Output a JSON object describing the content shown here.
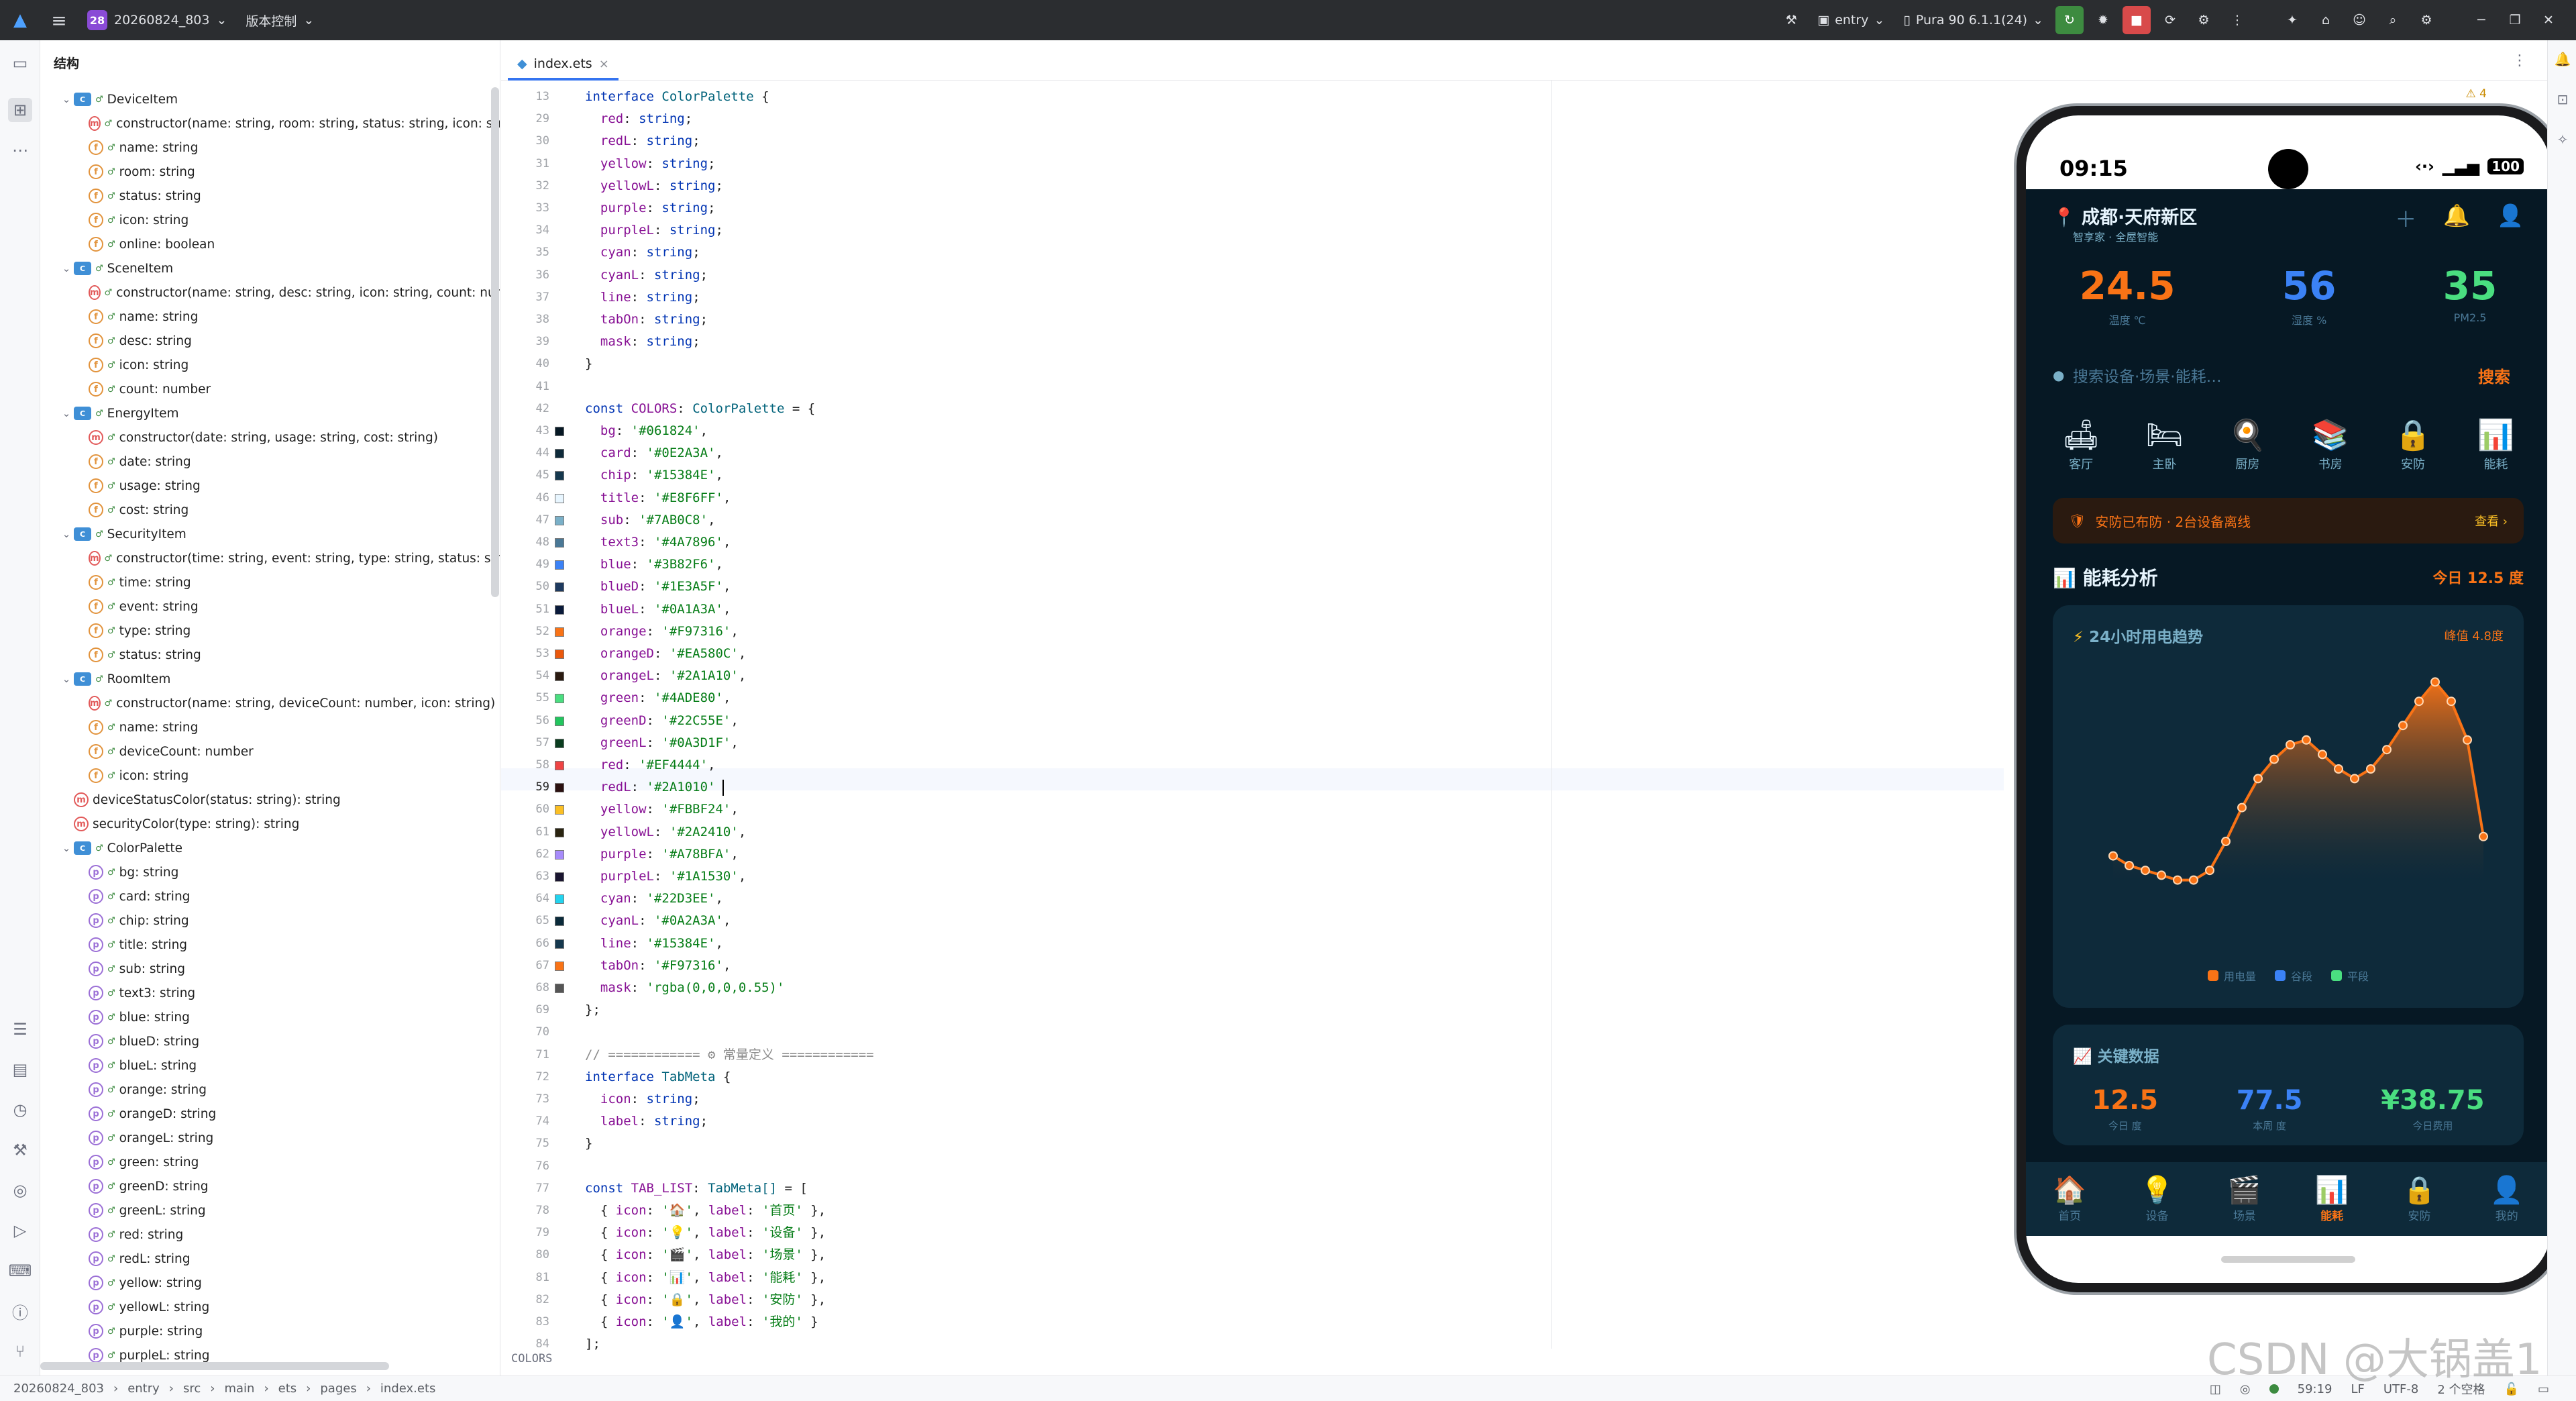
{
  "titlebar": {
    "project_badge": "28",
    "project_name": "20260824_803",
    "vcs": "版本控制",
    "run_config": "entry",
    "device": "Pura 90 6.1.1(24)"
  },
  "structure": {
    "title": "结构",
    "items": [
      {
        "level": 0,
        "kind": "class",
        "expand": true,
        "text": "DeviceItem"
      },
      {
        "level": 1,
        "kind": "method",
        "text": "constructor(name: string, room: string, status: string, icon: string,"
      },
      {
        "level": 1,
        "kind": "field",
        "text": "name: string"
      },
      {
        "level": 1,
        "kind": "field",
        "text": "room: string"
      },
      {
        "level": 1,
        "kind": "field",
        "text": "status: string"
      },
      {
        "level": 1,
        "kind": "field",
        "text": "icon: string"
      },
      {
        "level": 1,
        "kind": "field",
        "text": "online: boolean"
      },
      {
        "level": 0,
        "kind": "class",
        "expand": true,
        "text": "SceneItem"
      },
      {
        "level": 1,
        "kind": "method",
        "text": "constructor(name: string, desc: string, icon: string, count: number"
      },
      {
        "level": 1,
        "kind": "field",
        "text": "name: string"
      },
      {
        "level": 1,
        "kind": "field",
        "text": "desc: string"
      },
      {
        "level": 1,
        "kind": "field",
        "text": "icon: string"
      },
      {
        "level": 1,
        "kind": "field",
        "text": "count: number"
      },
      {
        "level": 0,
        "kind": "class",
        "expand": true,
        "text": "EnergyItem"
      },
      {
        "level": 1,
        "kind": "method",
        "text": "constructor(date: string, usage: string, cost: string)"
      },
      {
        "level": 1,
        "kind": "field",
        "text": "date: string"
      },
      {
        "level": 1,
        "kind": "field",
        "text": "usage: string"
      },
      {
        "level": 1,
        "kind": "field",
        "text": "cost: string"
      },
      {
        "level": 0,
        "kind": "class",
        "expand": true,
        "text": "SecurityItem"
      },
      {
        "level": 1,
        "kind": "method",
        "text": "constructor(time: string, event: string, type: string, status: string)"
      },
      {
        "level": 1,
        "kind": "field",
        "text": "time: string"
      },
      {
        "level": 1,
        "kind": "field",
        "text": "event: string"
      },
      {
        "level": 1,
        "kind": "field",
        "text": "type: string"
      },
      {
        "level": 1,
        "kind": "field",
        "text": "status: string"
      },
      {
        "level": 0,
        "kind": "class",
        "expand": true,
        "text": "RoomItem"
      },
      {
        "level": 1,
        "kind": "method",
        "text": "constructor(name: string, deviceCount: number, icon: string)"
      },
      {
        "level": 1,
        "kind": "field",
        "text": "name: string"
      },
      {
        "level": 1,
        "kind": "field",
        "text": "deviceCount: number"
      },
      {
        "level": 1,
        "kind": "field",
        "text": "icon: string"
      },
      {
        "level": 0,
        "kind": "func",
        "text": "deviceStatusColor(status: string): string"
      },
      {
        "level": 0,
        "kind": "func",
        "text": "securityColor(type: string): string"
      },
      {
        "level": 0,
        "kind": "class",
        "expand": true,
        "text": "ColorPalette"
      },
      {
        "level": 1,
        "kind": "prop",
        "text": "bg: string"
      },
      {
        "level": 1,
        "kind": "prop",
        "text": "card: string"
      },
      {
        "level": 1,
        "kind": "prop",
        "text": "chip: string"
      },
      {
        "level": 1,
        "kind": "prop",
        "text": "title: string"
      },
      {
        "level": 1,
        "kind": "prop",
        "text": "sub: string"
      },
      {
        "level": 1,
        "kind": "prop",
        "text": "text3: string"
      },
      {
        "level": 1,
        "kind": "prop",
        "text": "blue: string"
      },
      {
        "level": 1,
        "kind": "prop",
        "text": "blueD: string"
      },
      {
        "level": 1,
        "kind": "prop",
        "text": "blueL: string"
      },
      {
        "level": 1,
        "kind": "prop",
        "text": "orange: string"
      },
      {
        "level": 1,
        "kind": "prop",
        "text": "orangeD: string"
      },
      {
        "level": 1,
        "kind": "prop",
        "text": "orangeL: string"
      },
      {
        "level": 1,
        "kind": "prop",
        "text": "green: string"
      },
      {
        "level": 1,
        "kind": "prop",
        "text": "greenD: string"
      },
      {
        "level": 1,
        "kind": "prop",
        "text": "greenL: string"
      },
      {
        "level": 1,
        "kind": "prop",
        "text": "red: string"
      },
      {
        "level": 1,
        "kind": "prop",
        "text": "redL: string"
      },
      {
        "level": 1,
        "kind": "prop",
        "text": "yellow: string"
      },
      {
        "level": 1,
        "kind": "prop",
        "text": "yellowL: string"
      },
      {
        "level": 1,
        "kind": "prop",
        "text": "purple: string"
      },
      {
        "level": 1,
        "kind": "prop",
        "text": "purpleL: string"
      }
    ]
  },
  "editor": {
    "tab": "index.ets",
    "inspection": "⚠ 4",
    "breadcrumb": "COLORS",
    "lines": [
      {
        "n": "13",
        "text": "interface ColorPalette {",
        "style": "kw-head"
      },
      {
        "n": "29",
        "text": "  red: string;",
        "style": "field"
      },
      {
        "n": "30",
        "text": "  redL: string;",
        "style": "field"
      },
      {
        "n": "31",
        "text": "  yellow: string;",
        "style": "field"
      },
      {
        "n": "32",
        "text": "  yellowL: string;",
        "style": "field"
      },
      {
        "n": "33",
        "text": "  purple: string;",
        "style": "field"
      },
      {
        "n": "34",
        "text": "  purpleL: string;",
        "style": "field"
      },
      {
        "n": "35",
        "text": "  cyan: string;",
        "style": "field"
      },
      {
        "n": "36",
        "text": "  cyanL: string;",
        "style": "field"
      },
      {
        "n": "37",
        "text": "  line: string;",
        "style": "field"
      },
      {
        "n": "38",
        "text": "  tabOn: string;",
        "style": "field"
      },
      {
        "n": "39",
        "text": "  mask: string;",
        "style": "field"
      },
      {
        "n": "40",
        "text": "}",
        "style": "plain"
      },
      {
        "n": "41",
        "text": "",
        "style": "plain"
      },
      {
        "n": "42",
        "text": "const COLORS: ColorPalette = {",
        "style": "const-head"
      },
      {
        "n": "43",
        "text": "  bg: '#061824',",
        "style": "color",
        "swatch": "#061824"
      },
      {
        "n": "44",
        "text": "  card: '#0E2A3A',",
        "style": "color",
        "swatch": "#0E2A3A"
      },
      {
        "n": "45",
        "text": "  chip: '#15384E',",
        "style": "color",
        "swatch": "#15384E"
      },
      {
        "n": "46",
        "text": "  title: '#E8F6FF',",
        "style": "color",
        "swatch": "#E8F6FF"
      },
      {
        "n": "47",
        "text": "  sub: '#7AB0C8',",
        "style": "color",
        "swatch": "#7AB0C8"
      },
      {
        "n": "48",
        "text": "  text3: '#4A7896',",
        "style": "color",
        "swatch": "#4A7896"
      },
      {
        "n": "49",
        "text": "  blue: '#3B82F6',",
        "style": "color",
        "swatch": "#3B82F6"
      },
      {
        "n": "50",
        "text": "  blueD: '#1E3A5F',",
        "style": "color",
        "swatch": "#1E3A5F"
      },
      {
        "n": "51",
        "text": "  blueL: '#0A1A3A',",
        "style": "color",
        "swatch": "#0A1A3A"
      },
      {
        "n": "52",
        "text": "  orange: '#F97316',",
        "style": "color",
        "swatch": "#F97316"
      },
      {
        "n": "53",
        "text": "  orangeD: '#EA580C',",
        "style": "color",
        "swatch": "#EA580C"
      },
      {
        "n": "54",
        "text": "  orangeL: '#2A1A10',",
        "style": "color",
        "swatch": "#2A1A10"
      },
      {
        "n": "55",
        "text": "  green: '#4ADE80',",
        "style": "color",
        "swatch": "#4ADE80"
      },
      {
        "n": "56",
        "text": "  greenD: '#22C55E',",
        "style": "color",
        "swatch": "#22C55E"
      },
      {
        "n": "57",
        "text": "  greenL: '#0A3D1F',",
        "style": "color",
        "swatch": "#0A3D1F"
      },
      {
        "n": "58",
        "text": "  red: '#EF4444',",
        "style": "color",
        "swatch": "#EF4444"
      },
      {
        "n": "59",
        "text": "  redL: '#2A1010'",
        "style": "color",
        "swatch": "#2A1010",
        "current": true
      },
      {
        "n": "60",
        "text": "  yellow: '#FBBF24',",
        "style": "color",
        "swatch": "#FBBF24"
      },
      {
        "n": "61",
        "text": "  yellowL: '#2A2410',",
        "style": "color",
        "swatch": "#2A2410"
      },
      {
        "n": "62",
        "text": "  purple: '#A78BFA',",
        "style": "color",
        "swatch": "#A78BFA"
      },
      {
        "n": "63",
        "text": "  purpleL: '#1A1530',",
        "style": "color",
        "swatch": "#1A1530"
      },
      {
        "n": "64",
        "text": "  cyan: '#22D3EE',",
        "style": "color",
        "swatch": "#22D3EE"
      },
      {
        "n": "65",
        "text": "  cyanL: '#0A2A3A',",
        "style": "color",
        "swatch": "#0A2A3A"
      },
      {
        "n": "66",
        "text": "  line: '#15384E',",
        "style": "color",
        "swatch": "#15384E"
      },
      {
        "n": "67",
        "text": "  tabOn: '#F97316',",
        "style": "color",
        "swatch": "#F97316"
      },
      {
        "n": "68",
        "text": "  mask: 'rgba(0,0,0,0.55)'",
        "style": "color",
        "swatch": "#555555"
      },
      {
        "n": "69",
        "text": "};",
        "style": "plain"
      },
      {
        "n": "70",
        "text": "",
        "style": "plain"
      },
      {
        "n": "71",
        "text": "// ============ ⚙ 常量定义 ============",
        "style": "comment"
      },
      {
        "n": "72",
        "text": "interface TabMeta {",
        "style": "kw-head"
      },
      {
        "n": "73",
        "text": "  icon: string;",
        "style": "field"
      },
      {
        "n": "74",
        "text": "  label: string;",
        "style": "field"
      },
      {
        "n": "75",
        "text": "}",
        "style": "plain"
      },
      {
        "n": "76",
        "text": "",
        "style": "plain"
      },
      {
        "n": "77",
        "text": "const TAB_LIST: TabMeta[] = [",
        "style": "const-head"
      },
      {
        "n": "78",
        "text": "  { icon: '🏠', label: '首页' },",
        "style": "obj"
      },
      {
        "n": "79",
        "text": "  { icon: '💡', label: '设备' },",
        "style": "obj"
      },
      {
        "n": "80",
        "text": "  { icon: '🎬', label: '场景' },",
        "style": "obj"
      },
      {
        "n": "81",
        "text": "  { icon: '📊', label: '能耗' },",
        "style": "obj"
      },
      {
        "n": "82",
        "text": "  { icon: '🔒', label: '安防' },",
        "style": "obj"
      },
      {
        "n": "83",
        "text": "  { icon: '👤', label: '我的' }",
        "style": "obj"
      },
      {
        "n": "84",
        "text": "];",
        "style": "plain"
      }
    ]
  },
  "statusbar": {
    "crumbs": [
      "20260824_803",
      "entry",
      "src",
      "main",
      "ets",
      "pages",
      "index.ets"
    ],
    "position": "59:19",
    "line_sep": "LF",
    "encoding": "UTF-8",
    "indent": "2 个空格"
  },
  "phone": {
    "time": "09:15",
    "battery": "100",
    "location": "成都·天府新区",
    "location_sub": "智享家 · 全屋智能",
    "metrics": [
      {
        "value": "24.5",
        "label": "温度 ℃",
        "color": "#F97316"
      },
      {
        "value": "56",
        "label": "湿度 %",
        "color": "#3B82F6"
      },
      {
        "value": "35",
        "label": "PM2.5",
        "color": "#4ADE80"
      }
    ],
    "search_placeholder": "搜索设备·场景·能耗…",
    "search_button": "搜索",
    "rooms": [
      {
        "icon": "🛋",
        "label": "客厅"
      },
      {
        "icon": "🛏",
        "label": "主卧"
      },
      {
        "icon": "🍳",
        "label": "厨房"
      },
      {
        "icon": "📚",
        "label": "书房"
      },
      {
        "icon": "🔒",
        "label": "安防"
      },
      {
        "icon": "📊",
        "label": "能耗"
      }
    ],
    "alert_text": "安防已布防 · 2台设备离线",
    "alert_action": "查看 ›",
    "energy_title": "能耗分析",
    "energy_today": "今日 12.5 度",
    "trend_title": "24小时用电趋势",
    "trend_peak": "峰值 4.8度",
    "legend": [
      {
        "label": "用电量",
        "color": "#F97316"
      },
      {
        "label": "谷段",
        "color": "#3B82F6"
      },
      {
        "label": "平段",
        "color": "#4ADE80"
      }
    ],
    "key_title": "关键数据",
    "key_data": [
      {
        "value": "12.5",
        "label": "今日 度",
        "color": "#F97316"
      },
      {
        "value": "77.5",
        "label": "本周 度",
        "color": "#3B82F6"
      },
      {
        "value": "¥38.75",
        "label": "今日费用",
        "color": "#4ADE80"
      }
    ],
    "nav": [
      {
        "icon": "🏠",
        "label": "首页",
        "active": false
      },
      {
        "icon": "💡",
        "label": "设备",
        "active": false
      },
      {
        "icon": "🎬",
        "label": "场景",
        "active": false
      },
      {
        "icon": "📊",
        "label": "能耗",
        "active": true
      },
      {
        "icon": "🔒",
        "label": "安防",
        "active": false
      },
      {
        "icon": "👤",
        "label": "我的",
        "active": false
      }
    ]
  },
  "chart_data": {
    "type": "area",
    "x": [
      0,
      1,
      2,
      3,
      4,
      5,
      6,
      7,
      8,
      9,
      10,
      11,
      12,
      13,
      14,
      15,
      16,
      17,
      18,
      19,
      20,
      21,
      22,
      23
    ],
    "series": [
      {
        "values": [
          1.2,
          1.0,
          0.9,
          0.8,
          0.7,
          0.7,
          0.9,
          1.5,
          2.2,
          2.8,
          3.2,
          3.5,
          3.6,
          3.3,
          3.0,
          2.8,
          3.0,
          3.4,
          3.9,
          4.4,
          4.8,
          4.4,
          3.6,
          1.6
        ]
      }
    ],
    "ylim": [
      0,
      5
    ],
    "grid": false,
    "legend": "bottom"
  },
  "watermark": "CSDN @大锅盖1"
}
